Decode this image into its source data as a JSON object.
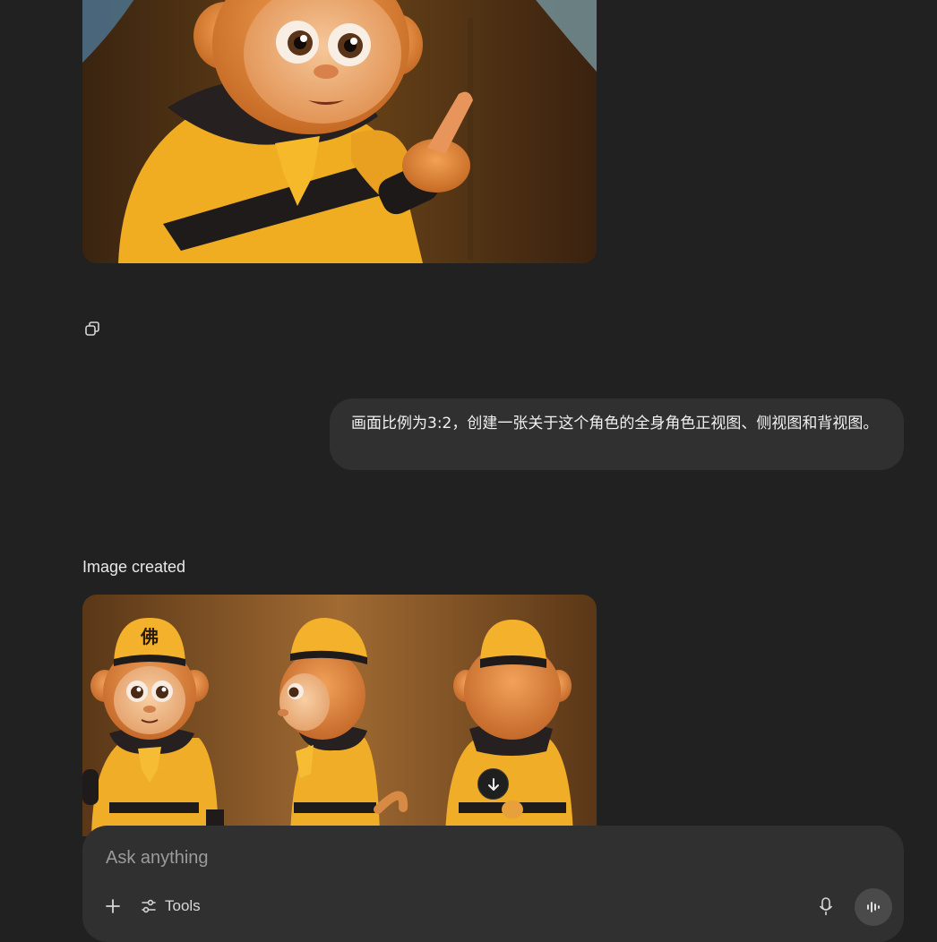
{
  "conversation": {
    "user_message": "画面比例为3:2，创建一张关于这个角色的全身角色正视图、侧视图和背视图。",
    "image_status": "Image created",
    "hat_glyph": "佛"
  },
  "icons": {
    "copy": "copy-icon",
    "scroll_down": "arrow-down-icon",
    "plus": "plus-icon",
    "tools": "sliders-icon",
    "mic": "microphone-icon",
    "voice": "voice-waveform-icon"
  },
  "composer": {
    "placeholder": "Ask anything",
    "tools_label": "Tools"
  },
  "colors": {
    "background": "#212121",
    "bubble": "#303030",
    "composer": "#303030"
  }
}
